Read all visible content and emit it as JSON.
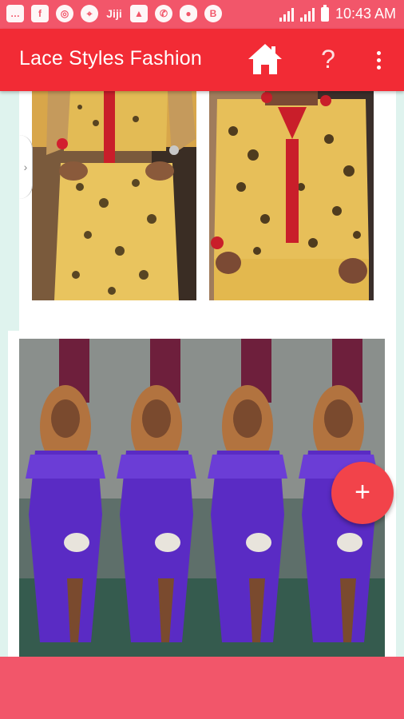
{
  "status_bar": {
    "time": "10:43 AM",
    "icons": [
      "message-icon",
      "facebook-icon",
      "dribbble-icon",
      "compass-icon",
      "jiji-icon",
      "image-icon",
      "whatsapp-icon",
      "eye-icon",
      "bitcoin-icon"
    ],
    "jiji_text": "Jiji"
  },
  "app_bar": {
    "title": "Lace Styles Fashion",
    "help_label": "?",
    "home_icon": "home-icon",
    "menu_icon": "overflow-menu-icon"
  },
  "fab": {
    "label": "+"
  },
  "colors": {
    "status_bar": "#f2566a",
    "app_bar": "#f22b35",
    "fab": "#f2434a",
    "background": "#dff3ee",
    "dress_gold": "#e8c15a",
    "dress_purple": "#5a2bc4"
  },
  "gallery": {
    "items": [
      {
        "name": "gold-lace-outfit-photo-left"
      },
      {
        "name": "gold-lace-outfit-photo-right"
      },
      {
        "name": "purple-lace-dress-collage"
      }
    ]
  }
}
